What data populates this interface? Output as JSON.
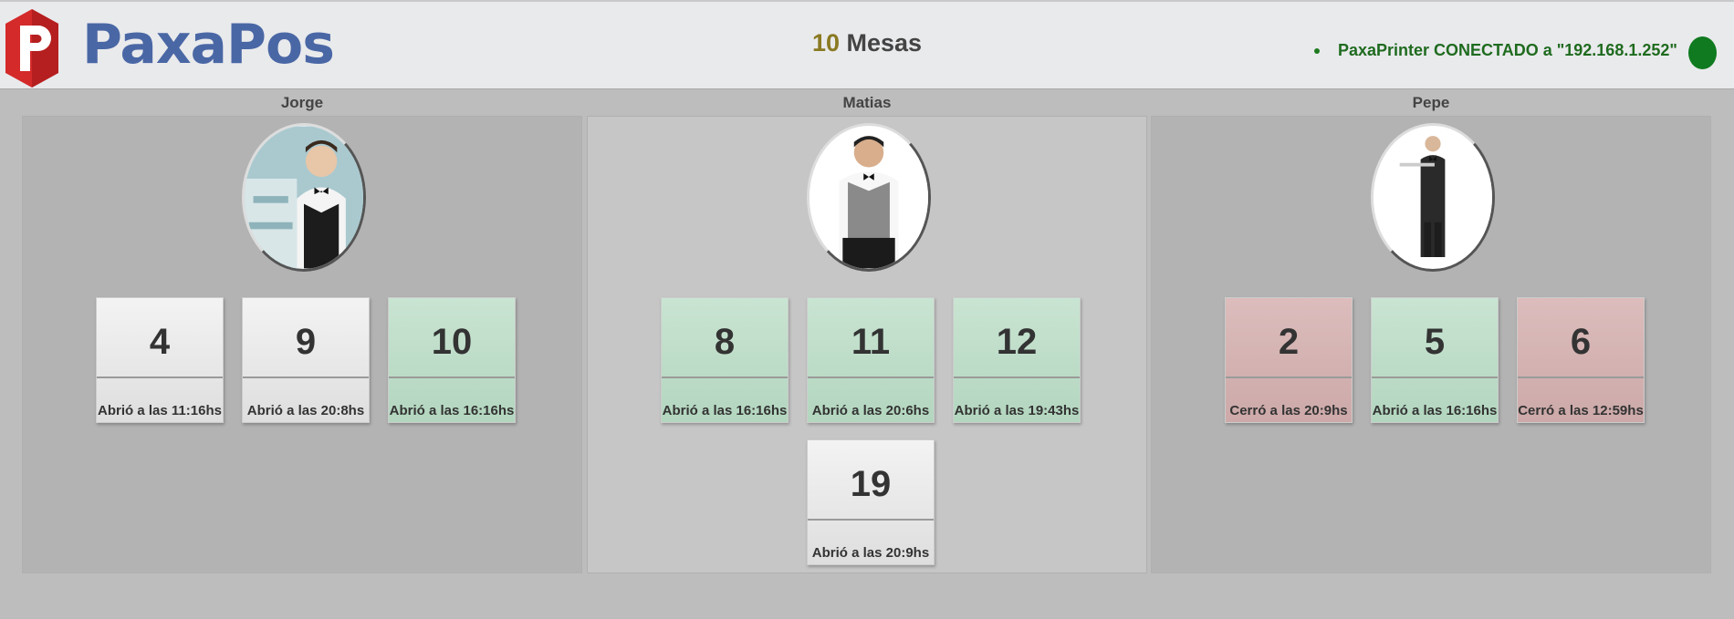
{
  "header": {
    "brand": "PaxaPos",
    "count": {
      "number": "10",
      "label": " Mesas"
    },
    "printer_status": "PaxaPrinter CONECTADO a \"192.168.1.252\"",
    "status_color": "#0f7a1f"
  },
  "waiters": [
    {
      "name": "Jorge",
      "tables": [
        {
          "number": "4",
          "status": "Abrió a las 11:16hs",
          "color": "gray"
        },
        {
          "number": "9",
          "status": "Abrió a las 20:8hs",
          "color": "gray"
        },
        {
          "number": "10",
          "status": "Abrió a las 16:16hs",
          "color": "green"
        }
      ]
    },
    {
      "name": "Matias",
      "tables": [
        {
          "number": "8",
          "status": "Abrió a las 16:16hs",
          "color": "green"
        },
        {
          "number": "11",
          "status": "Abrió a las 20:6hs",
          "color": "green"
        },
        {
          "number": "12",
          "status": "Abrió a las 19:43hs",
          "color": "green"
        },
        {
          "number": "19",
          "status": "Abrió a las 20:9hs",
          "color": "gray"
        }
      ]
    },
    {
      "name": "Pepe",
      "tables": [
        {
          "number": "2",
          "status": "Cerró a las 20:9hs",
          "color": "red"
        },
        {
          "number": "5",
          "status": "Abrió a las 16:16hs",
          "color": "green"
        },
        {
          "number": "6",
          "status": "Cerró a las 12:59hs",
          "color": "red"
        }
      ]
    }
  ]
}
